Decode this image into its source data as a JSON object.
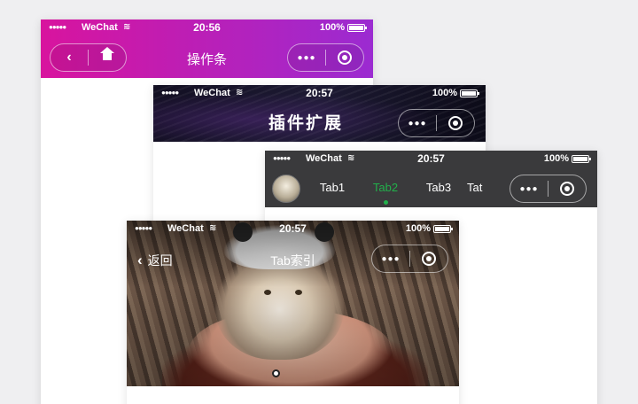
{
  "status_bar": {
    "signal": "●●●●●",
    "carrier": "WeChat",
    "battery": "100%"
  },
  "screens": [
    {
      "time": "20:56",
      "title": "操作条",
      "header_colors": [
        "#d8149e",
        "#9b2bd1"
      ]
    },
    {
      "time": "20:57",
      "title": "插件扩展"
    },
    {
      "time": "20:57",
      "tabs": [
        "Tab1",
        "Tab2",
        "Tab3",
        "Tat"
      ],
      "active_tab": "Tab2",
      "accent": "#22b04b"
    },
    {
      "time": "20:57",
      "back_label": "返回",
      "title": "Tab索引"
    }
  ],
  "capsule": {
    "more_icon": "●●●",
    "close_icon": "record-circle-icon"
  }
}
